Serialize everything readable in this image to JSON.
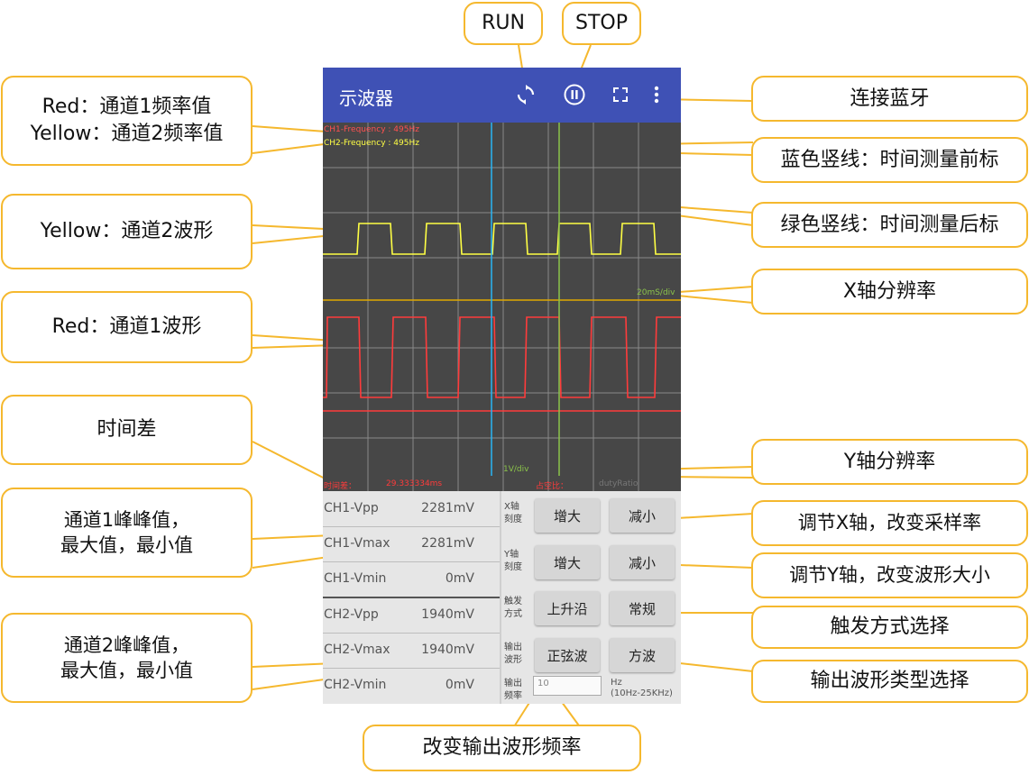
{
  "app": {
    "title": "示波器"
  },
  "scope": {
    "ch1_frequency": "CH1-Frequency : 495Hz",
    "ch2_frequency": "CH2-Frequency : 495Hz",
    "x_scale": "20mS/div",
    "y_scale": "1V/div",
    "time_diff_label": "时间差：",
    "time_diff_value": "29.333334ms",
    "duty_label": "占空比：",
    "duty_value": "dutyRatio",
    "colors": {
      "ch1": "#ff3b3b",
      "ch2": "#ffff44",
      "blue_cursor": "#29b6f6",
      "green_cursor": "#8bc34a",
      "trigger_line": "#e0a800",
      "background": "#474747"
    }
  },
  "measurements": [
    {
      "label": "CH1-Vpp",
      "value": "2281mV"
    },
    {
      "label": "CH1-Vmax",
      "value": "2281mV"
    },
    {
      "label": "CH1-Vmin",
      "value": "0mV"
    },
    {
      "label": "CH2-Vpp",
      "value": "1940mV"
    },
    {
      "label": "CH2-Vmax",
      "value": "1940mV"
    },
    {
      "label": "CH2-Vmin",
      "value": "0mV"
    }
  ],
  "controls": {
    "x_label": "X轴\n刻度",
    "y_label": "Y轴\n刻度",
    "trigger_label": "触发\n方式",
    "wave_label": "输出\n波形",
    "freq_label": "输出\n频率",
    "x_inc": "增大",
    "x_dec": "减小",
    "y_inc": "增大",
    "y_dec": "减小",
    "trigger_rising": "上升沿",
    "trigger_normal": "常规",
    "wave_sine": "正弦波",
    "wave_square": "方波",
    "freq_placeholder": "10",
    "freq_unit": "Hz\n(10Hz-25KHz)"
  },
  "icons": {
    "run": "refresh-icon",
    "stop": "pause-circle-icon",
    "fullscreen": "fullscreen-icon",
    "menu": "more-vert-icon"
  },
  "callouts": {
    "run": "RUN",
    "stop": "STOP",
    "freq_values": "Red：通道1频率值\nYellow：通道2频率值",
    "bluetooth": "连接蓝牙",
    "blue_cursor": "蓝色竖线：时间测量前标",
    "green_cursor": "绿色竖线：时间测量后标",
    "ch2_wave": "Yellow：通道2波形",
    "x_resolution": "X轴分辨率",
    "ch1_wave": "Red：通道1波形",
    "time_diff": "时间差",
    "y_resolution": "Y轴分辨率",
    "ch1_stats": "通道1峰峰值，\n最大值，最小值",
    "adjust_x": "调节X轴，改变采样率",
    "adjust_y": "调节Y轴，改变波形大小",
    "trigger_mode": "触发方式选择",
    "ch2_stats": "通道2峰峰值，\n最大值，最小值",
    "output_wave": "输出波形类型选择",
    "output_freq": "改变输出波形频率"
  }
}
